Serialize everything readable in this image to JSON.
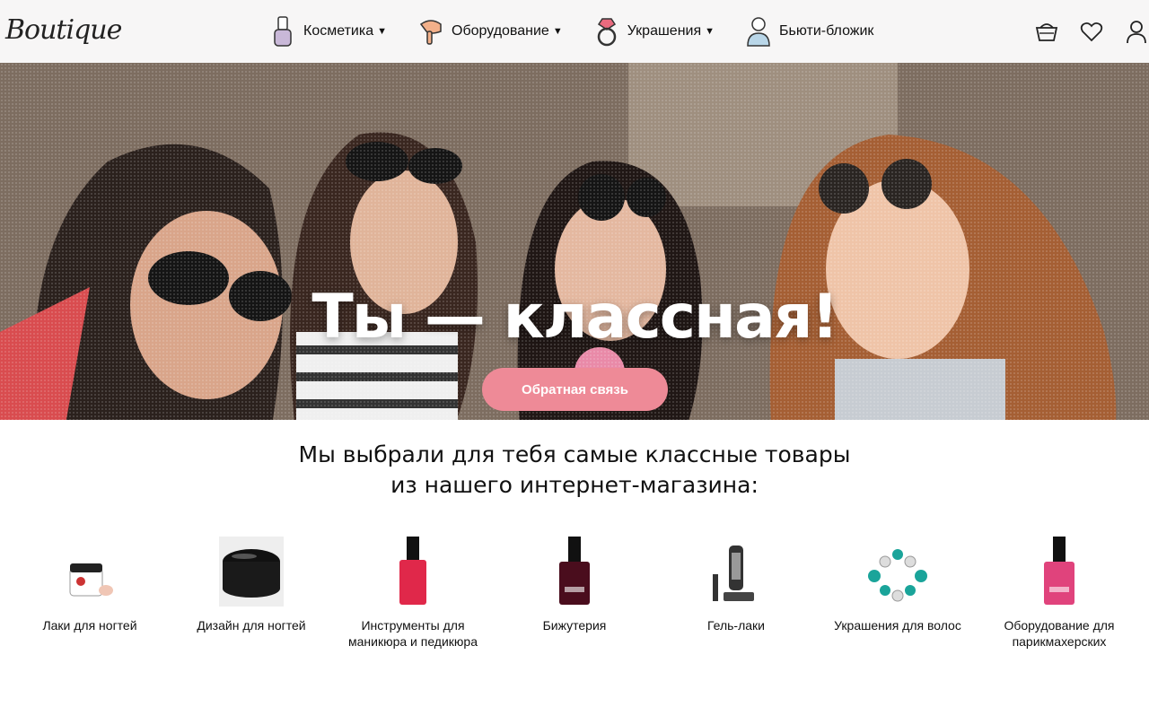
{
  "header": {
    "logo": "Boutique",
    "nav": [
      {
        "label": "Косметика",
        "icon": "nail-polish-icon",
        "has_dropdown": true
      },
      {
        "label": "Оборудование",
        "icon": "hair-dryer-icon",
        "has_dropdown": true
      },
      {
        "label": "Украшения",
        "icon": "ring-icon",
        "has_dropdown": true
      },
      {
        "label": "Бьюти-бложик",
        "icon": "blogger-icon",
        "has_dropdown": false
      }
    ],
    "icons": [
      "basket-icon",
      "heart-icon",
      "user-icon"
    ]
  },
  "hero": {
    "title": "Ты — классная!",
    "button_label": "Обратная связь"
  },
  "section": {
    "heading_line1": "Мы выбрали для тебя самые классные товары",
    "heading_line2": "из нашего интернет-магазина:"
  },
  "products": [
    {
      "label": "Лаки для ногтей",
      "icon": "nail-gel-jar-icon"
    },
    {
      "label": "Дизайн для ногтей",
      "icon": "black-jar-icon"
    },
    {
      "label": "Инструменты для маникюра и педикюра",
      "icon": "red-nail-polish-icon"
    },
    {
      "label": "Бижутерия",
      "icon": "dark-nail-polish-icon"
    },
    {
      "label": "Гель-лаки",
      "icon": "hair-trimmer-icon"
    },
    {
      "label": "Украшения для волос",
      "icon": "bead-bracelet-icon"
    },
    {
      "label": "Оборудование для парикмахерских",
      "icon": "pink-nail-polish-icon"
    }
  ],
  "colors": {
    "accent_button": "#ee8a97",
    "header_bg": "#f7f6f6"
  }
}
